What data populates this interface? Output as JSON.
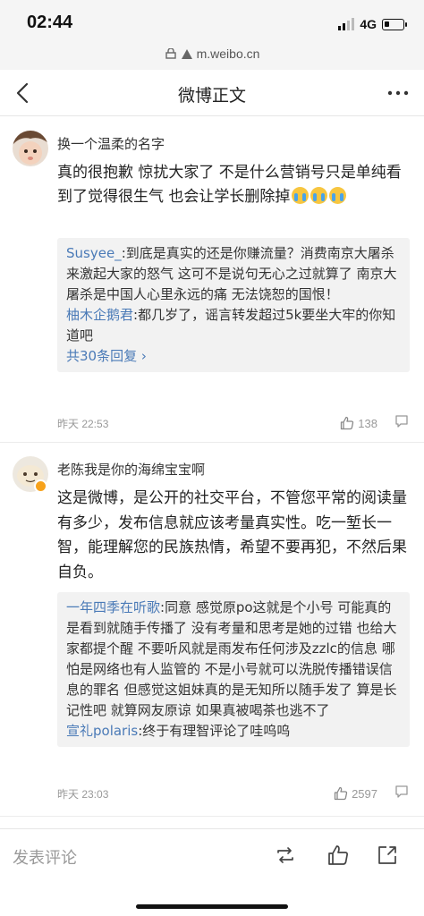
{
  "status_bar": {
    "time": "02:44",
    "network": "4G"
  },
  "url_bar": {
    "url": "m.weibo.cn"
  },
  "nav": {
    "title": "微博正文",
    "back_icon": "chevron-left-icon",
    "more_icon": "more-dots-icon"
  },
  "comments": [
    {
      "username": "换一个温柔的名字",
      "text": "真的很抱歉 惊扰大家了 不是什么营销号只是单纯看到了觉得很生气 也会让学长删除掉",
      "emoji_count": 3,
      "replies": [
        {
          "user": "Susyee_",
          "text": ":到底是真实的还是你赚流量？消费南京大屠杀来激起大家的怒气 这可不是说句无心之过就算了 南京大屠杀是中国人心里永远的痛 无法饶恕的国恨！"
        },
        {
          "user": "柚木企鹅君",
          "text": ":都几岁了，谣言转发超过5k要坐大牢的你知道吧"
        }
      ],
      "more_replies": "共30条回复",
      "timestamp": "昨天 22:53",
      "likes": "138"
    },
    {
      "username": "老陈我是你的海绵宝宝啊",
      "text": "这是微博，是公开的社交平台，不管您平常的阅读量有多少，发布信息就应该考量真实性。吃一堑长一智，能理解您的民族热情，希望不要再犯，不然后果自负。",
      "replies": [
        {
          "user": "一年四季在听歌",
          "text": ":同意 感觉原po这就是个小号 可能真的是看到就随手传播了 没有考量和思考是她的过错 也给大家都提个醒 不要听风就是雨发布任何涉及zzlc的信息 哪怕是网络也有人监管的 不是小号就可以洗脱传播错误信息的罪名 但感觉这姐妹真的是无知所以随手发了 算是长记性吧 就算网友原谅 如果真被喝茶也逃不了"
        },
        {
          "user": "宣礼polaris",
          "text": ":终于有理智评论了哇呜呜"
        }
      ],
      "timestamp": "昨天 23:03",
      "likes": "2597"
    }
  ],
  "bottom_bar": {
    "post_comment_label": "发表评论",
    "icons": [
      "repost-icon",
      "like-icon",
      "share-icon"
    ]
  }
}
